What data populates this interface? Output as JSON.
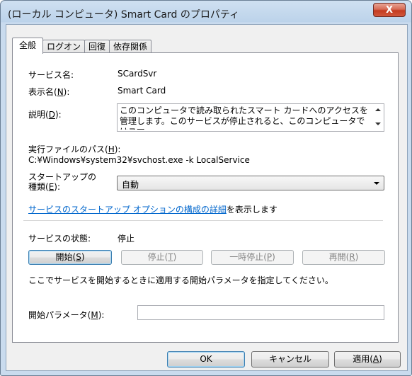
{
  "window": {
    "title": "(ローカル コンピュータ) Smart Card のプロパティ",
    "close_label": "X"
  },
  "tabs": [
    {
      "label": "全般",
      "active": true
    },
    {
      "label": "ログオン",
      "active": false
    },
    {
      "label": "回復",
      "active": false
    },
    {
      "label": "依存関係",
      "active": false
    }
  ],
  "general": {
    "service_name_label": "サービス名:",
    "service_name_value": "SCardSvr",
    "display_name_label_pre": "表示名(",
    "display_name_label_key": "N",
    "display_name_label_post": "):",
    "display_name_value": "Smart Card",
    "description_label_pre": "説明(",
    "description_label_key": "D",
    "description_label_post": "):",
    "description_value": "このコンピュータで読み取られたスマート カードへのアクセスを管理します。このサービスが停止されると、このコンピュータではスマ",
    "exe_path_label_pre": "実行ファイルのパス(",
    "exe_path_label_key": "H",
    "exe_path_label_post": "):",
    "exe_path_value": "C:¥Windows¥system32¥svchost.exe -k LocalService",
    "startup_type_label_line1": "スタートアップの",
    "startup_type_label_line2_pre": "種類(",
    "startup_type_label_key": "E",
    "startup_type_label_line2_post": "):",
    "startup_type_value": "自動",
    "startup_help_link": "サービスのスタートアップ オプションの構成の詳細",
    "startup_help_suffix": "を表示します",
    "status_label": "サービスの状態:",
    "status_value": "停止",
    "buttons": {
      "start": {
        "pre": "開始(",
        "key": "S",
        "post": ")"
      },
      "stop": {
        "pre": "停止(",
        "key": "T",
        "post": ")"
      },
      "pause": {
        "pre": "一時停止(",
        "key": "P",
        "post": ")"
      },
      "resume": {
        "pre": "再開(",
        "key": "R",
        "post": ")"
      }
    },
    "start_param_hint": "ここでサービスを開始するときに適用する開始パラメータを指定してください。",
    "start_param_label_pre": "開始パラメータ(",
    "start_param_label_key": "M",
    "start_param_label_post": "):",
    "start_param_value": ""
  },
  "footer": {
    "ok_label": "OK",
    "cancel_label": "キャンセル",
    "apply_pre": "適用(",
    "apply_key": "A",
    "apply_post": ")"
  }
}
